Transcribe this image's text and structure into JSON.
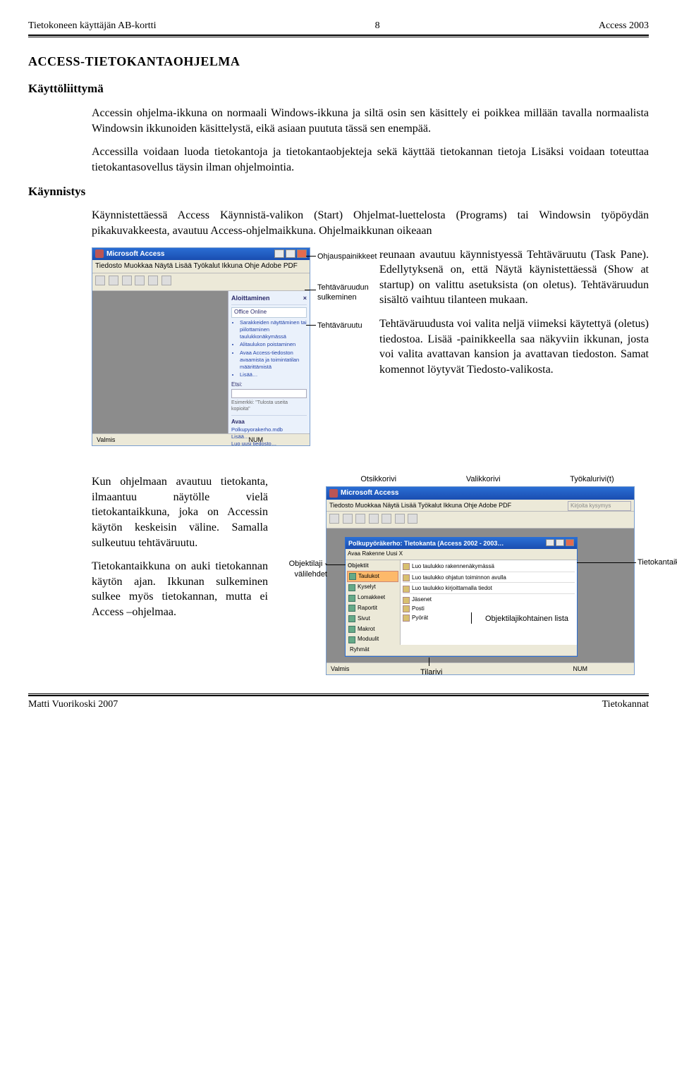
{
  "header": {
    "left": "Tietokoneen käyttäjän AB-kortti",
    "center": "8",
    "right": "Access 2003"
  },
  "title": "ACCESS-TIETOKANTAOHJELMA",
  "section1": "Käyttöliittymä",
  "para1": "Accessin ohjelma-ikkuna on normaali Windows-ikkuna ja siltä osin sen käsittely ei poikkea millään tavalla normaalista Windowsin ikkunoiden käsittelystä, eikä asiaan puututa tässä sen enempää.",
  "para2": "Accessilla voidaan luoda tietokantoja ja tietokantaobjekteja sekä käyttää tietokannan tietoja Lisäksi voidaan toteuttaa tietokantasovellus täysin ilman ohjelmointia.",
  "section2": "Käynnistys",
  "para3": "Käynnistettäessä Access Käynnistä-valikon (Start) Ohjelmat-luettelosta (Programs) tai Windowsin työpöydän pikakuvakkeesta, avautuu Access-ohjelmaikkuna. Ohjelmaikkunan oikeaan",
  "para4": "reunaan avautuu käynnistyessä Tehtäväruutu (Task Pane). Edellytyksenä on, että Näytä käynistettäessä (Show at startup) on valittu asetuksista (on oletus). Tehtäväruudun sisältö vaihtuu tilanteen mukaan.",
  "para5": "Tehtäväruudusta voi valita neljä viimeksi käytettyä (oletus) tiedostoa. Lisää -painikkeella saa näkyviin ikkunan, josta voi valita avattavan kansion ja avattavan tiedoston. Samat komennot löytyvät Tiedosto-valikosta.",
  "para6": "Kun ohjelmaan avautuu tietokanta, ilmaantuu näytölle vielä tietokantaikkuna, joka on Accessin käytön keskeisin väline. Samalla sulkeutuu tehtäväruutu.",
  "para7": "Tietokantaikkuna on auki tietokannan käytön ajan. Ikkunan sulkeminen sulkee myös tietokannan, mutta ei Access –ohjelmaa.",
  "screenshot1": {
    "app_title": "Microsoft Access",
    "menubar": "Tiedosto  Muokkaa  Näytä  Lisää  Työkalut  Ikkuna  Ohje  Adobe PDF",
    "pane_title": "Aloittaminen",
    "office_online": "Office Online",
    "bullets": [
      "Sarakkeiden näyttäminen tai piilottaminen taulukkonäkymässä",
      "Alitaulukon poistaminen",
      "Avaa Access-tiedoston avaamista ja toimintatilan määrittämistä",
      "Lisää…"
    ],
    "etsi_label": "Etsi:",
    "esim": "Esimerkki: \"Tulosta useita kopioita\"",
    "avaa_label": "Avaa",
    "file1": "Polkupyorakerho.mdb",
    "file2": "Lisää…",
    "file3": "Luo uusi tiedosto…",
    "status_left": "Valmis",
    "status_mid": "NUM",
    "callouts": {
      "c1": "Ohjauspainikkeet",
      "c2": "Tehtäväruudun sulkeminen",
      "c3": "Tehtäväruutu"
    }
  },
  "screenshot2": {
    "labels_top": {
      "a": "Otsikkorivi",
      "b": "Valikkorivi",
      "c": "Työkalurivi(t)"
    },
    "app_title": "Microsoft Access",
    "menubar": "Tiedosto  Muokkaa  Näytä  Lisää  Työkalut  Ikkuna  Ohje  Adobe PDF",
    "search_placeholder": "Kirjoita kysymys",
    "inner_title": "Polkupyöräkerho: Tietokanta (Access 2002 - 2003…",
    "inner_toolbar": "Avaa   Rakenne   Uusi   X",
    "tabs_header": "Objektit",
    "tabs": [
      "Taulukot",
      "Kyselyt",
      "Lomakkeet",
      "Raportit",
      "Sivut",
      "Makrot",
      "Moduulit"
    ],
    "list_items": [
      "Luo taulukko rakennenäkymässä",
      "Luo taulukko ohjatun toiminnon avulla",
      "Luo taulukko kirjoittamalla tiedot",
      "Jäsenet",
      "Posti",
      "Pyörät"
    ],
    "ryhmat": "Ryhmät",
    "status_left": "Valmis",
    "status_mid": "NUM",
    "callouts": {
      "left": "Objektilaji -välilehdet",
      "right": "Tietokantaikkuna",
      "mid": "Objektilajikohtainen lista",
      "bottom": "Tilarivi"
    }
  },
  "footer": {
    "left": "Matti Vuorikoski  2007",
    "right": "Tietokannat"
  }
}
